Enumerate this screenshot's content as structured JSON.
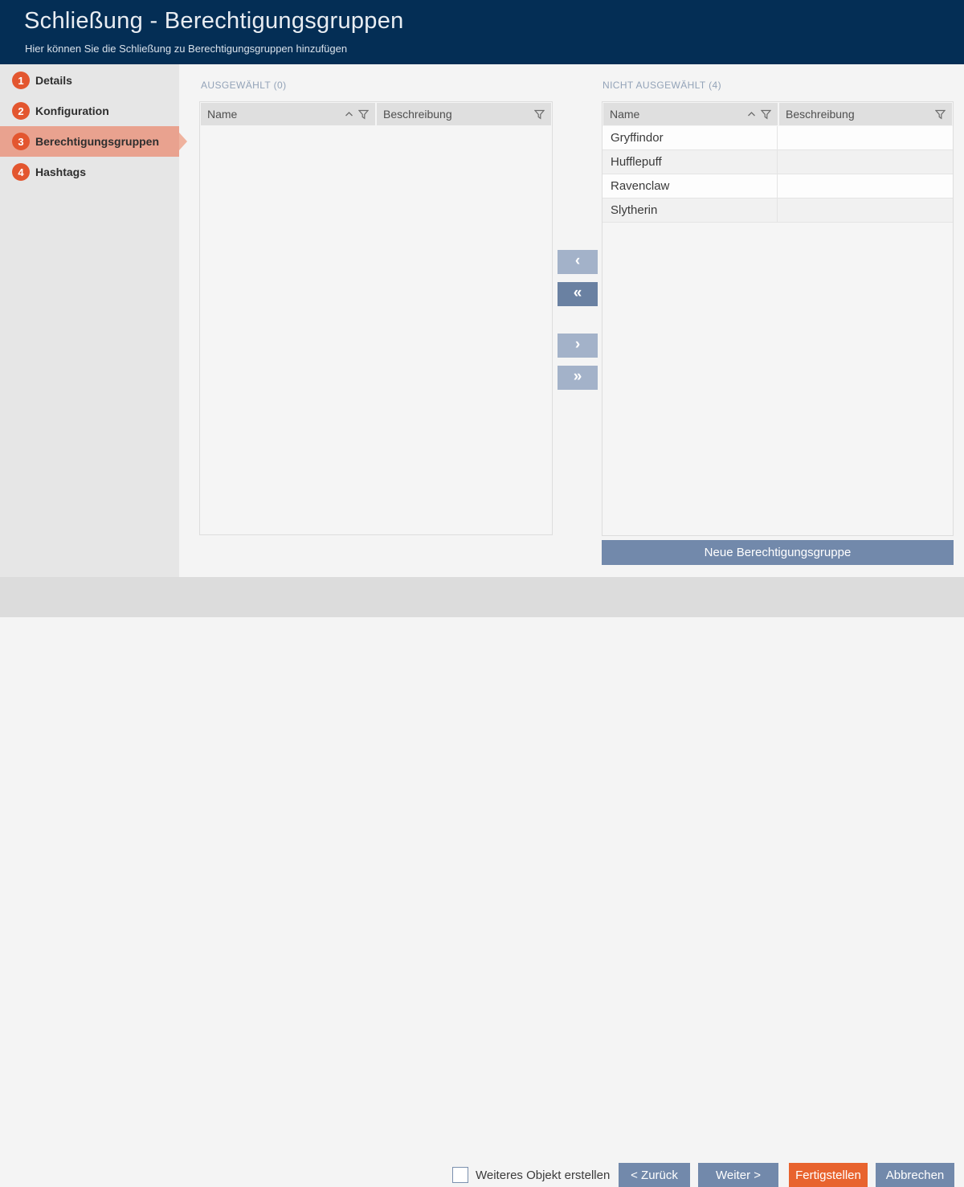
{
  "window": {
    "title": "Schließung - Berechtigungsgruppen",
    "subtitle": "Hier können Sie die Schließung zu Berechtigungsgruppen hinzufügen"
  },
  "sidebar": {
    "items": [
      {
        "number": "1",
        "label": "Details",
        "active": false
      },
      {
        "number": "2",
        "label": "Konfiguration",
        "active": false
      },
      {
        "number": "3",
        "label": "Berechtigungsgruppen",
        "active": true
      },
      {
        "number": "4",
        "label": "Hashtags",
        "active": false
      }
    ]
  },
  "selected_panel": {
    "heading": "AUSGEWÄHLT (0)",
    "count": 0,
    "sort": "ascending",
    "columns": {
      "name": "Name",
      "description": "Beschreibung"
    },
    "rows": []
  },
  "unselected_panel": {
    "heading": "NICHT AUSGEWÄHLT (4)",
    "count": 4,
    "sort": "ascending",
    "columns": {
      "name": "Name",
      "description": "Beschreibung"
    },
    "rows": [
      {
        "name": "Gryffindor",
        "description": ""
      },
      {
        "name": "Hufflepuff",
        "description": ""
      },
      {
        "name": "Ravenclaw",
        "description": ""
      },
      {
        "name": "Slytherin",
        "description": ""
      }
    ],
    "new_group_button": "Neue Berechtigungsgruppe"
  },
  "transfer_buttons": {
    "move_left": "‹",
    "move_all_left": "«",
    "move_right": "›",
    "move_all_right": "»"
  },
  "footer": {
    "create_another_label": "Weiteres Objekt erstellen",
    "create_another_checked": false,
    "back": "< Zurück",
    "next": "Weiter >",
    "finish": "Fertigstellen",
    "cancel": "Abbrechen"
  },
  "icons": {
    "sort_ascending": "chevron-up",
    "filter": "funnel"
  },
  "colors": {
    "header_bg": "#042e55",
    "accent_orange": "#e3562f",
    "active_step_bg": "#e9a28f",
    "button_blue": "#7289ab",
    "transfer_button_light": "#a3b2c9",
    "transfer_button_dark": "#6a81a2",
    "finish_orange": "#e8632e",
    "footer_bg": "#dcdcdc"
  }
}
